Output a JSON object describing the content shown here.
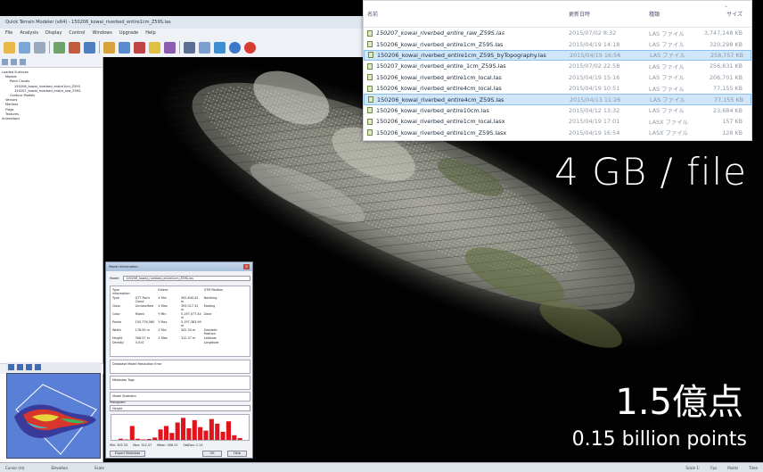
{
  "app": {
    "title": "Quick Terrain Modeler (x64) - 150206_kowai_riverbed_entire1cm_Z59S.las",
    "menu": [
      "File",
      "Analysis",
      "Display",
      "Control",
      "Windows",
      "Upgrade",
      "Help"
    ],
    "status": {
      "left": [
        "Cursor (m)",
        "Elevation",
        "Scale"
      ],
      "right": [
        "Scale 1:",
        "Fps",
        "Points",
        "Time"
      ]
    }
  },
  "tree": {
    "items": [
      {
        "label": "Loaded Surfaces",
        "level": 0
      },
      {
        "label": "Models",
        "level": 1
      },
      {
        "label": "Point Clouds",
        "level": 2
      },
      {
        "label": "150206_kowai_riverbed_entire1cm_Z59S",
        "level": 3
      },
      {
        "label": "150207_kowai_riverbed_entire_raw_Z59S",
        "level": 3
      },
      {
        "label": "Contour Models",
        "level": 2
      },
      {
        "label": "Vectors",
        "level": 1
      },
      {
        "label": "Markers",
        "level": 1
      },
      {
        "label": "Flags",
        "level": 1
      },
      {
        "label": "Textures",
        "level": 1
      },
      {
        "label": "Animations",
        "level": 0
      }
    ]
  },
  "explorer": {
    "columns": {
      "name": "名前",
      "date": "更新日時",
      "type": "種類",
      "size": "サイズ"
    },
    "rows": [
      {
        "name": "150207_kowai_riverbed_entire_raw_Z59S.las",
        "date": "2015/07/02 8:32",
        "type": "LAS ファイル",
        "size": "3,747,148 KB",
        "selected": false,
        "italic": true
      },
      {
        "name": "150206_kowai_riverbed_entire1cm_Z59S.las",
        "date": "2015/04/19 14:18",
        "type": "LAS ファイル",
        "size": "320,298 KB",
        "selected": false
      },
      {
        "name": "150206_kowai_riverbed_entire1cm_Z59S_byTopography.las",
        "date": "2015/04/19 16:56",
        "type": "LAS ファイル",
        "size": "258,757 KB",
        "selected": true
      },
      {
        "name": "150207_kowai_riverbed_entire_1cm_Z59S.las",
        "date": "2015/07/02 22:58",
        "type": "LAS ファイル",
        "size": "256,831 KB",
        "selected": false
      },
      {
        "name": "150206_kowai_riverbed_entire1cm_local.las",
        "date": "2015/04/19 15:16",
        "type": "LAS ファイル",
        "size": "206,701 KB",
        "selected": false
      },
      {
        "name": "150206_kowai_riverbed_entire4cm_local.las",
        "date": "2015/04/19 10:51",
        "type": "LAS ファイル",
        "size": "77,155 KB",
        "selected": false
      },
      {
        "name": "150206_kowai_riverbed_entire4cm_Z59S.las",
        "date": "2015/04/13 11:26",
        "type": "LAS ファイル",
        "size": "77,155 KB",
        "selected": true
      },
      {
        "name": "150206_kowai_riverbed_entire10cm.las",
        "date": "2015/04/12 13:32",
        "type": "LAS ファイル",
        "size": "23,684 KB",
        "selected": false
      },
      {
        "name": "150206_kowai_riverbed_entire1cm_local.lasx",
        "date": "2015/04/19 17:01",
        "type": "LASX ファイル",
        "size": "157 KB",
        "selected": false
      },
      {
        "name": "150206_kowai_riverbed_entire1cm_Z59S.lasx",
        "date": "2015/04/19 16:54",
        "type": "LASX ファイル",
        "size": "128 KB",
        "selected": false
      }
    ]
  },
  "captions": {
    "file_size": "4 GB / file",
    "points_jp": "1.5億点",
    "points_en": "0.15 billion points"
  },
  "dialog": {
    "title": "Model Information",
    "model_label": "Model:",
    "model_value": "150206_kowai_riverbed_entire1cm_Z59S.las",
    "grid": [
      "Type Information",
      "",
      "Extent",
      "",
      "UTM Position",
      "",
      "Type",
      "QTT Point Cloud",
      "X Min",
      "392,840.42 m",
      "Northing",
      "",
      "Class",
      "Unclassified",
      "X Max",
      "393,017.32 m",
      "Easting",
      "",
      "Color",
      "Mixed",
      "Y Min",
      "5,197,077.44 m",
      "Zone",
      "",
      "Points",
      "150,776,560",
      "Y Max",
      "5,197,383.99 m",
      "",
      "",
      "Width",
      "176.90 m",
      "Z Min",
      "302.33 m",
      "Geodetic Position",
      "",
      "Height",
      "306.57 m",
      "Z Max",
      "312.37 m",
      "Latitude",
      "",
      "Density",
      "0.010",
      "",
      "",
      "Longitude",
      ""
    ],
    "section_resolution": "Database Model Resolution Error",
    "section_metadata": "Metadata Tags",
    "section_sensor": "Model Statistics",
    "colormap_label": "Histogram",
    "colormap_value": "Height",
    "histogram": [
      0.05,
      0.02,
      0.6,
      0.05,
      0.02,
      0.04,
      0.1,
      0.45,
      0.6,
      0.3,
      0.75,
      0.95,
      0.5,
      0.85,
      0.55,
      0.4,
      0.9,
      0.7,
      0.35,
      0.8,
      0.2,
      0.08
    ],
    "stats": [
      "Min: 302.33",
      "Max: 312.37",
      "Mean: 306.22",
      "StdDev: 2.13"
    ],
    "buttons": {
      "export": "Export Metadata",
      "ok": "OK",
      "help": "Help"
    }
  }
}
